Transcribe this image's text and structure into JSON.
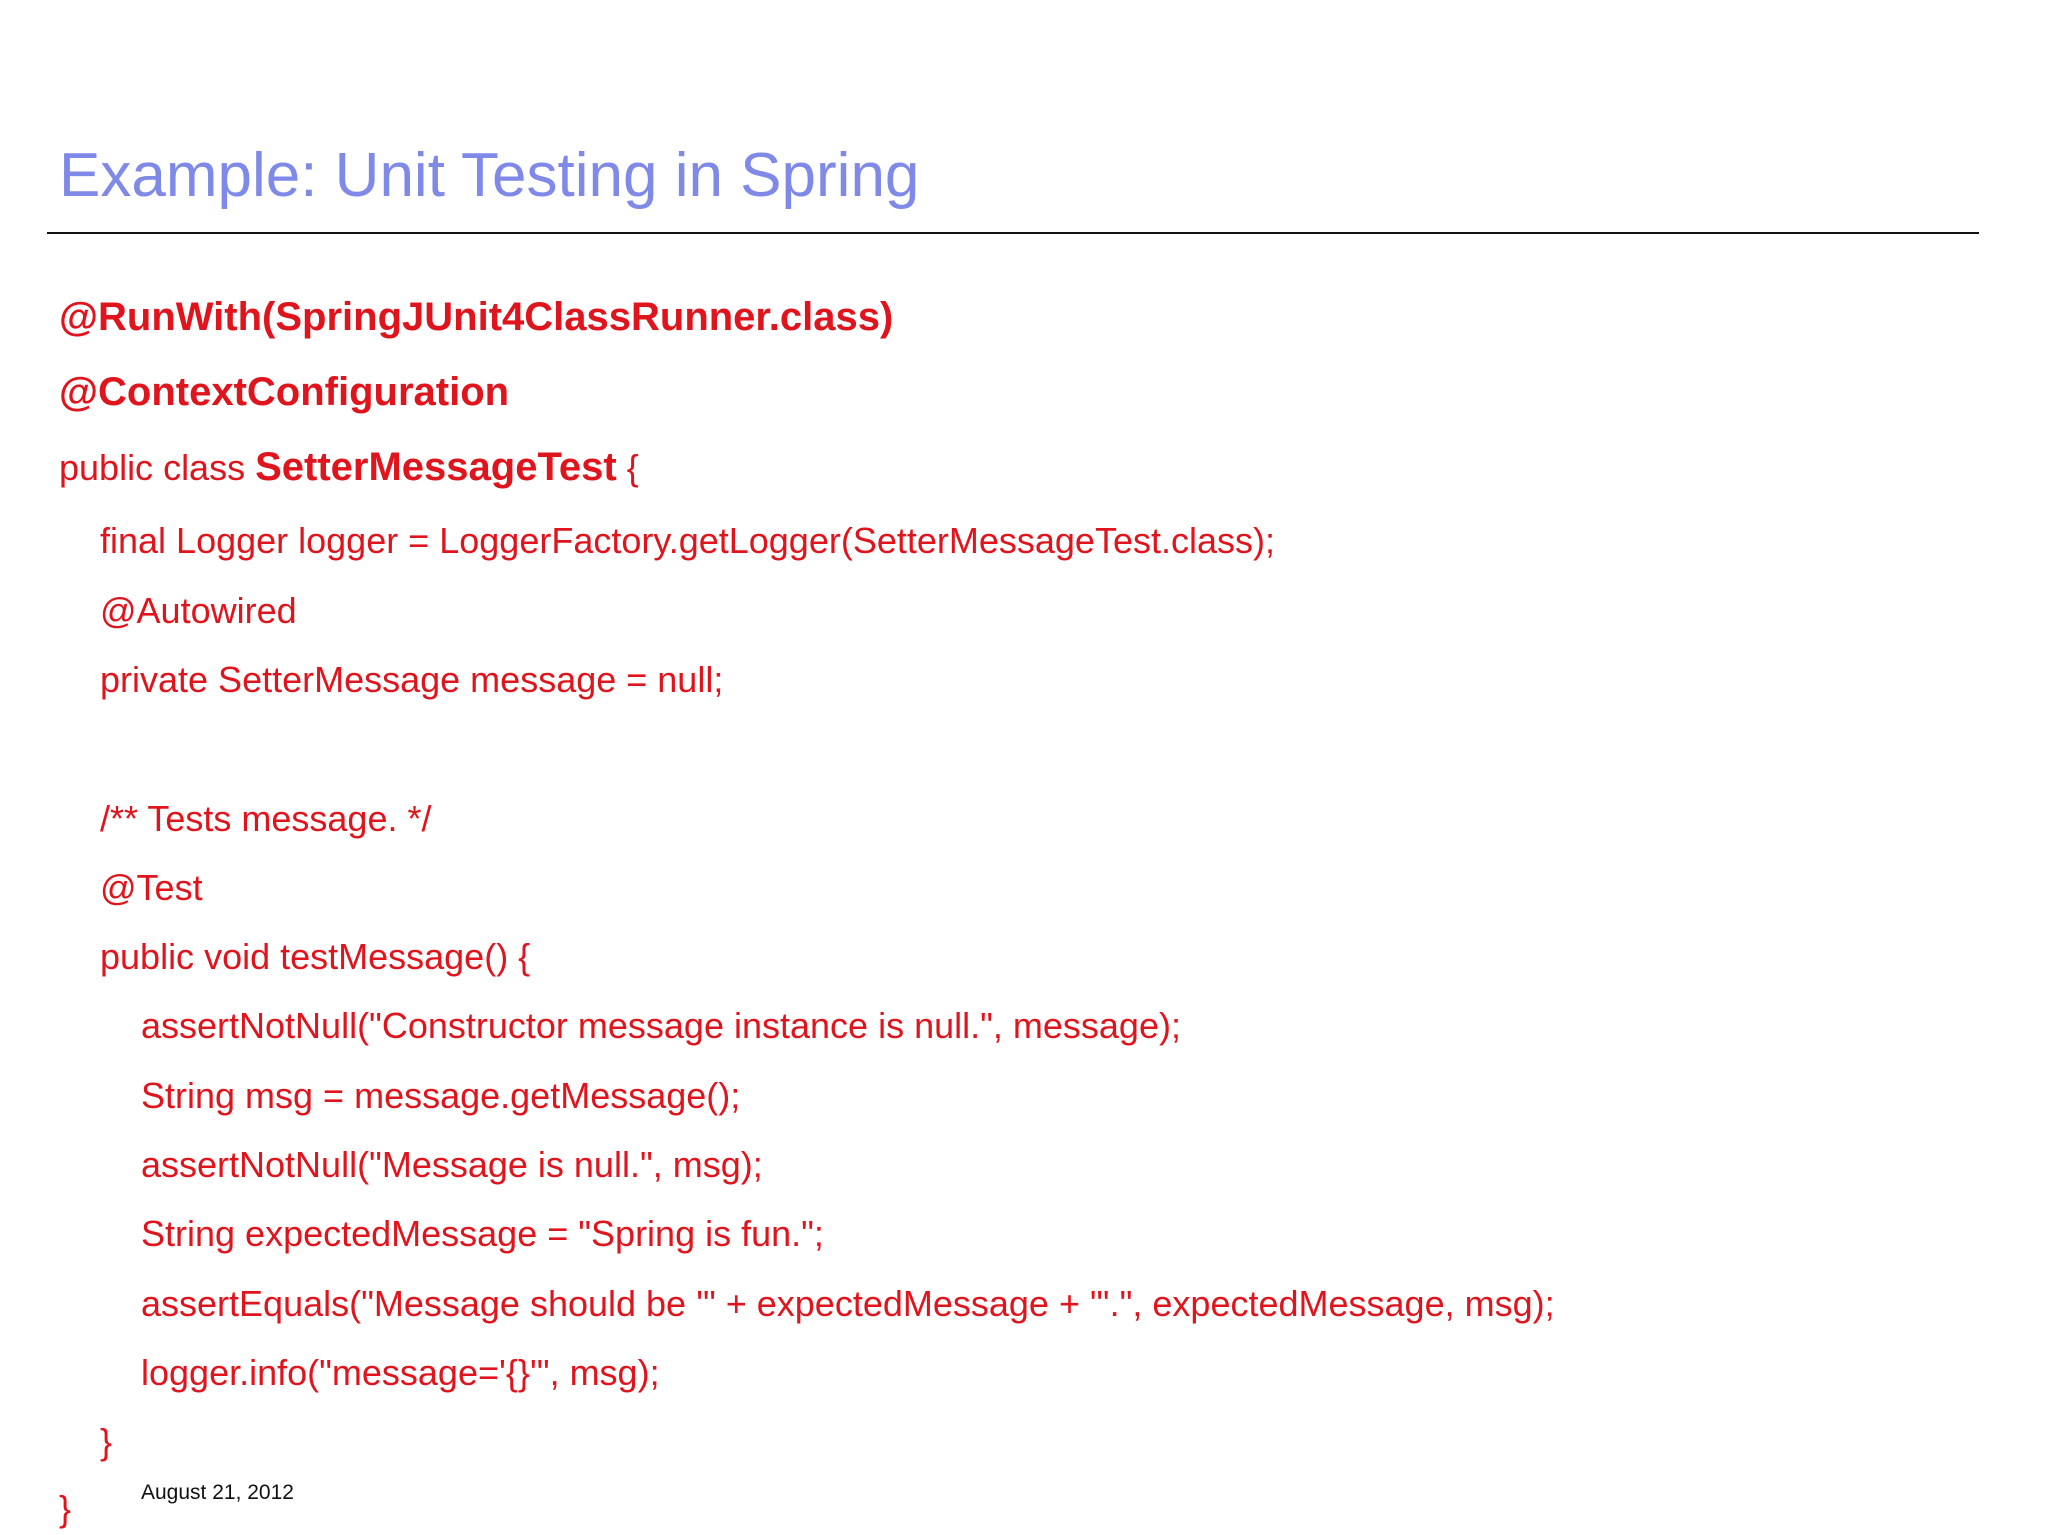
{
  "slide": {
    "title": "Example: Unit Testing in Spring",
    "date": "August 21, 2012",
    "code": {
      "line1": "@RunWith(SpringJUnit4ClassRunner.class)",
      "line2": "@ContextConfiguration",
      "line3_prefix": "public class ",
      "line3_classname": "SetterMessageTest",
      "line3_suffix": " {",
      "line4": "final Logger logger = LoggerFactory.getLogger(SetterMessageTest.class);",
      "line5": "@Autowired",
      "line6": "private SetterMessage message = null;",
      "line7": "/** Tests message. */",
      "line8": "@Test",
      "line9": "public void testMessage() {",
      "line10": "assertNotNull(\"Constructor message instance is null.\", message);",
      "line11": "String msg = message.getMessage();",
      "line12": "assertNotNull(\"Message is null.\", msg);",
      "line13": "String expectedMessage = \"Spring is fun.\";",
      "line14": "assertEquals(\"Message should be '\" + expectedMessage + \"'.\", expectedMessage, msg);",
      "line15": "logger.info(\"message='{}'\", msg);",
      "line16": "}",
      "line17": "}"
    }
  }
}
